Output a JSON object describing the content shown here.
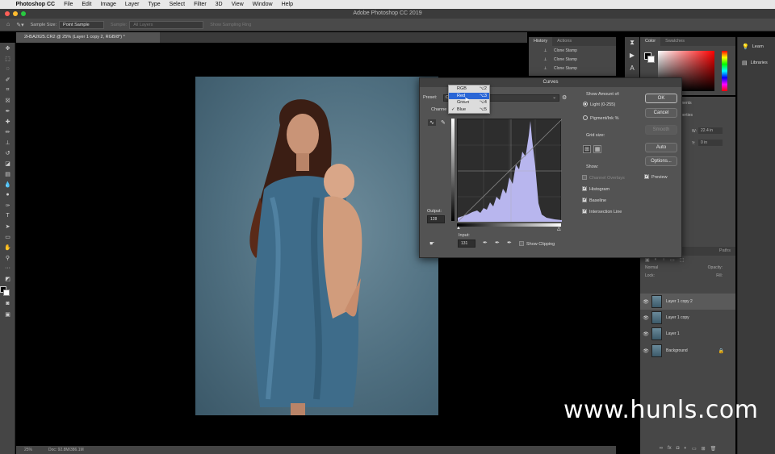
{
  "menubar": {
    "app_name": "Photoshop CC",
    "items": [
      "File",
      "Edit",
      "Image",
      "Layer",
      "Type",
      "Select",
      "Filter",
      "3D",
      "View",
      "Window",
      "Help"
    ]
  },
  "window": {
    "title": "Adobe Photoshop CC 2019"
  },
  "options_bar": {
    "sample_size_label": "Sample Size:",
    "sample_size_value": "Point Sample",
    "sample_label": "Sample:",
    "sample_value": "All Layers",
    "show_ring_label": "Show Sampling Ring"
  },
  "document": {
    "tab_title": "2H5A2625.CR2 @ 25% (Layer 1 copy 2, RGB/8*) *"
  },
  "status_bar": {
    "zoom": "25%",
    "doc_info": "Doc: 92.8M/386.1M"
  },
  "history_panel": {
    "tabs": [
      "History",
      "Actions"
    ],
    "items": [
      "Clone Stamp",
      "Clone Stamp",
      "Clone Stamp"
    ]
  },
  "color_panel": {
    "tabs": [
      "Color",
      "Swatches"
    ],
    "foreground": "#000000",
    "background": "#ffffff"
  },
  "learn_panel": {
    "items": [
      {
        "icon": "lightbulb-icon",
        "label": "Learn"
      },
      {
        "icon": "libraries-icon",
        "label": "Libraries"
      }
    ]
  },
  "properties_panel": {
    "tab_partial": "ments",
    "title_partial": "perties",
    "w_label": "W:",
    "w_value": "22.4 in",
    "y_label": "Y:",
    "y_value": "0 in"
  },
  "layers_panel": {
    "tabs": [
      "Paths"
    ],
    "kind_label": "Normal",
    "opacity_label": "Opacity:",
    "lock_label": "Lock:",
    "fill_label": "Fill:",
    "layers": [
      {
        "name": "Layer 1 copy 2",
        "active": true,
        "locked": false
      },
      {
        "name": "Layer 1 copy",
        "active": false,
        "locked": false
      },
      {
        "name": "Layer 1",
        "active": false,
        "locked": false
      },
      {
        "name": "Background",
        "active": false,
        "locked": true
      }
    ]
  },
  "curves_dialog": {
    "title": "Curves",
    "preset_label": "Preset:",
    "preset_value": "C",
    "channel_label": "Channe",
    "output_label": "Output:",
    "output_value": "128",
    "input_label": "Input:",
    "input_value": "131",
    "show_clipping_label": "Show Clipping",
    "show_amount_label": "Show Amount of:",
    "light_label": "Light  (0-255)",
    "pigment_label": "Pigment/Ink %",
    "grid_size_label": "Grid size:",
    "show_label": "Show:",
    "channel_overlays_label": "Channel Overlays",
    "histogram_label": "Histogram",
    "baseline_label": "Baseline",
    "intersection_label": "Intersection Line",
    "buttons": {
      "ok": "OK",
      "cancel": "Cancel",
      "smooth": "Smooth",
      "auto": "Auto",
      "options": "Options..."
    },
    "preview_label": "Preview",
    "channel_menu": [
      {
        "label": "RGB",
        "shortcut": "⌥2",
        "highlighted": false,
        "checked": false
      },
      {
        "label": "Red",
        "shortcut": "⌥3",
        "highlighted": true,
        "checked": false
      },
      {
        "label": "Green",
        "shortcut": "⌥4",
        "highlighted": false,
        "checked": false
      },
      {
        "label": "Blue",
        "shortcut": "⌥5",
        "highlighted": false,
        "checked": true
      }
    ],
    "histogram_color": "#b8b6ee"
  },
  "watermark": {
    "text": "www.hunls.com"
  }
}
